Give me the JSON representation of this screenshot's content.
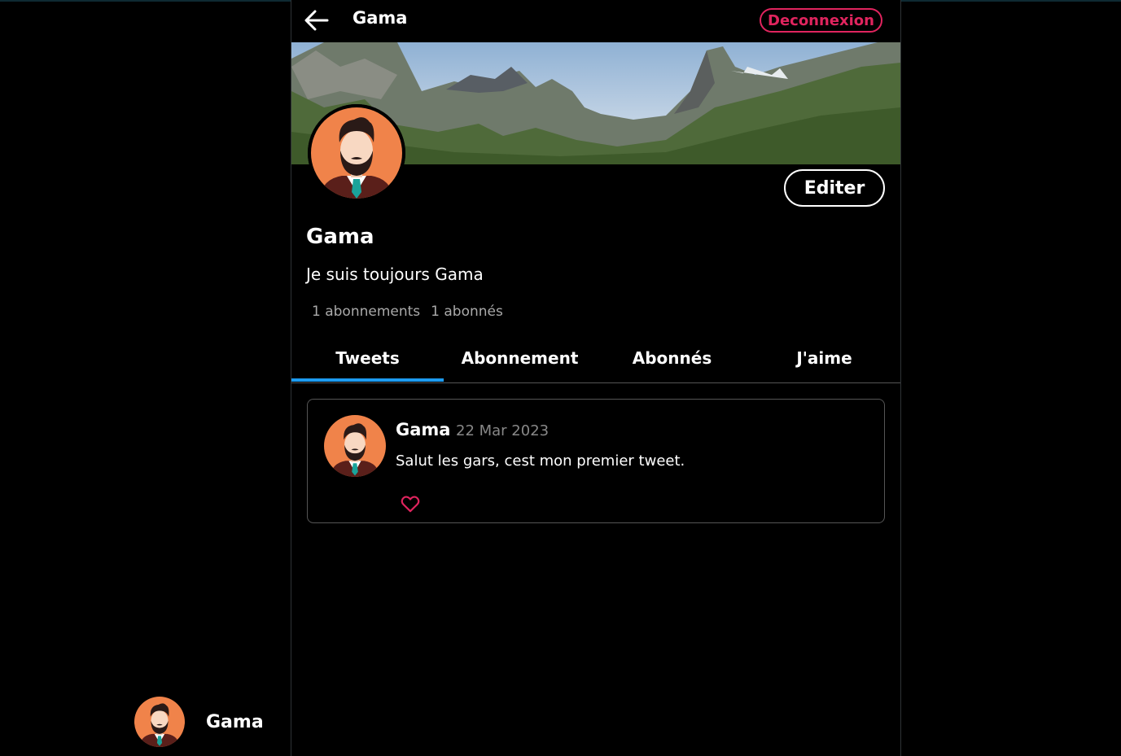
{
  "header": {
    "title": "Gama",
    "logout_label": "Deconnexion",
    "logout_color": "#e0245e"
  },
  "profile": {
    "name": "Gama",
    "bio": "Je suis toujours Gama",
    "edit_label": "Editer",
    "following": "1 abonnements",
    "followers": "1 abonnés"
  },
  "tabs": [
    {
      "label": "Tweets",
      "active": true
    },
    {
      "label": "Abonnement",
      "active": false
    },
    {
      "label": "Abonnés",
      "active": false
    },
    {
      "label": "J'aime",
      "active": false
    }
  ],
  "tweets": [
    {
      "author": "Gama",
      "date": "22 Mar 2023",
      "text": "Salut les gars, cest mon premier tweet.",
      "like_icon": "heart-icon"
    }
  ],
  "sidebar": {
    "account_name": "Gama"
  },
  "colors": {
    "accent": "#1d9bf0",
    "like": "#e0245e",
    "avatar_bg": "#f0834a"
  }
}
